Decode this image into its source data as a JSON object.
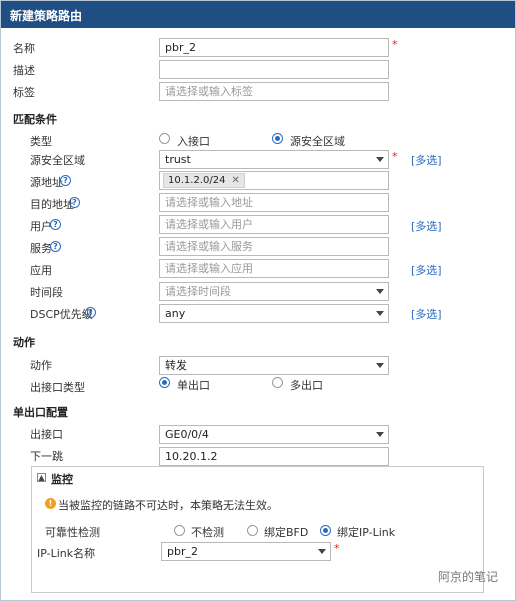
{
  "window": {
    "title": "新建策略路由"
  },
  "basic": {
    "name_label": "名称",
    "name_value": "pbr_2",
    "desc_label": "描述",
    "desc_value": "",
    "tag_label": "标签",
    "tag_placeholder": "请选择或输入标签"
  },
  "match": {
    "section_title": "匹配条件",
    "type_label": "类型",
    "type_options": [
      "入接口",
      "源安全区域"
    ],
    "type_selected": "源安全区域",
    "src_zone_label": "源安全区域",
    "src_zone_value": "trust",
    "src_addr_label": "源地址",
    "src_addr_tag": "10.1.2.0/24",
    "dst_addr_label": "目的地址",
    "dst_addr_placeholder": "请选择或输入地址",
    "user_label": "用户",
    "user_placeholder": "请选择或输入用户",
    "service_label": "服务",
    "service_placeholder": "请选择或输入服务",
    "app_label": "应用",
    "app_placeholder": "请选择或输入应用",
    "time_label": "时间段",
    "time_placeholder": "请选择时间段",
    "dscp_label": "DSCP优先级",
    "dscp_value": "any",
    "multi_select_label": "[多选]"
  },
  "action": {
    "section_title": "动作",
    "action_label": "动作",
    "action_value": "转发",
    "out_type_label": "出接口类型",
    "out_type_options": [
      "单出口",
      "多出口"
    ],
    "out_type_selected": "单出口"
  },
  "single_exit": {
    "section_title": "单出口配置",
    "out_if_label": "出接口",
    "out_if_value": "GE0/0/4",
    "next_hop_label": "下一跳",
    "next_hop_value": "10.20.1.2"
  },
  "monitor": {
    "title": "监控",
    "toggle_symbol": "▲",
    "warning_symbol": "!",
    "warning_text": "当被监控的链路不可达时，本策略无法生效。",
    "reliability_label": "可靠性检测",
    "reliability_options": [
      "不检测",
      "绑定BFD",
      "绑定IP-Link"
    ],
    "reliability_selected": "绑定IP-Link",
    "iplink_label": "IP-Link名称",
    "iplink_value": "pbr_2"
  },
  "required_mark": "*",
  "help_symbol": "?",
  "remove_symbol": "✕",
  "watermark": "阿京的笔记"
}
